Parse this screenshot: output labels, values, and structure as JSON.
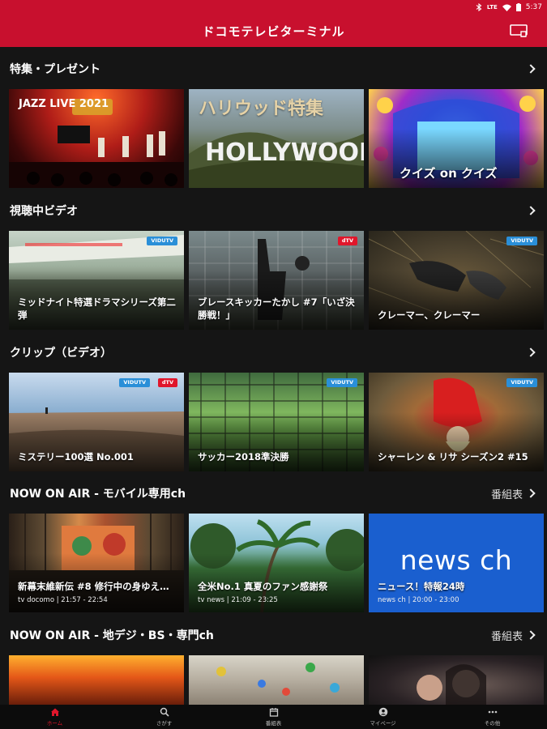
{
  "status": {
    "time": "5:37",
    "icons": [
      "bluetooth-icon",
      "lte-icon",
      "wifi-icon",
      "battery-icon"
    ]
  },
  "app": {
    "title": "ドコモテレビターミナル",
    "accent": "#c8102e"
  },
  "sections": [
    {
      "title": "特集・プレゼント",
      "right": "",
      "cards": [
        {
          "title": "JAZZ LIVE 2021",
          "sub": "",
          "badges": []
        },
        {
          "title": "ハリウッド特集",
          "sub": "",
          "badges": []
        },
        {
          "title": "クイズ on クイズ",
          "sub": "",
          "badges": []
        }
      ]
    },
    {
      "title": "視聴中ビデオ",
      "right": "",
      "cards": [
        {
          "title": "ミッドナイト特選ドラマシリーズ第二弾",
          "sub": "",
          "badges": [
            "VIDUTV"
          ]
        },
        {
          "title": "ブレースキッカーたかし #7「いざ決勝戦！」",
          "sub": "",
          "badges": [
            "dTV"
          ]
        },
        {
          "title": "クレーマー、クレーマー",
          "sub": "",
          "badges": [
            "VIDUTV"
          ]
        }
      ]
    },
    {
      "title": "クリップ（ビデオ）",
      "right": "",
      "cards": [
        {
          "title": "ミステリー100選 No.001",
          "sub": "",
          "badges": [
            "VIDUTV",
            "dTV"
          ]
        },
        {
          "title": "サッカー2018準決勝",
          "sub": "",
          "badges": [
            "VIDUTV"
          ]
        },
        {
          "title": "シャーレン & リサ シーズン2 #15",
          "sub": "",
          "badges": [
            "VIDUTV"
          ]
        }
      ]
    },
    {
      "title": "NOW ON AIR - モバイル専用ch",
      "right": "番組表",
      "cards": [
        {
          "title": "新幕末維新伝 #8 修行中の身ゆえ…",
          "sub": "tv docomo | 21:57 - 22:54",
          "badges": []
        },
        {
          "title": "全米No.1 真夏のファン感謝祭",
          "sub": "tv news | 21:09 - 23:25",
          "badges": []
        },
        {
          "title": "ニュース！特報24時",
          "sub": "news ch | 20:00 - 23:00",
          "badges": [],
          "image_text": "news ch"
        }
      ]
    },
    {
      "title": "NOW ON AIR - 地デジ・BS・専門ch",
      "right": "番組表",
      "cards": [
        {
          "title": "",
          "sub": "",
          "badges": []
        },
        {
          "title": "",
          "sub": "",
          "badges": []
        },
        {
          "title": "",
          "sub": "",
          "badges": []
        }
      ]
    }
  ],
  "nav": [
    {
      "label": "ホーム",
      "icon": "home-icon",
      "active": true
    },
    {
      "label": "さがす",
      "icon": "search-icon",
      "active": false
    },
    {
      "label": "番組表",
      "icon": "calendar-icon",
      "active": false
    },
    {
      "label": "マイページ",
      "icon": "person-icon",
      "active": false
    },
    {
      "label": "その他",
      "icon": "more-icon",
      "active": false
    }
  ]
}
